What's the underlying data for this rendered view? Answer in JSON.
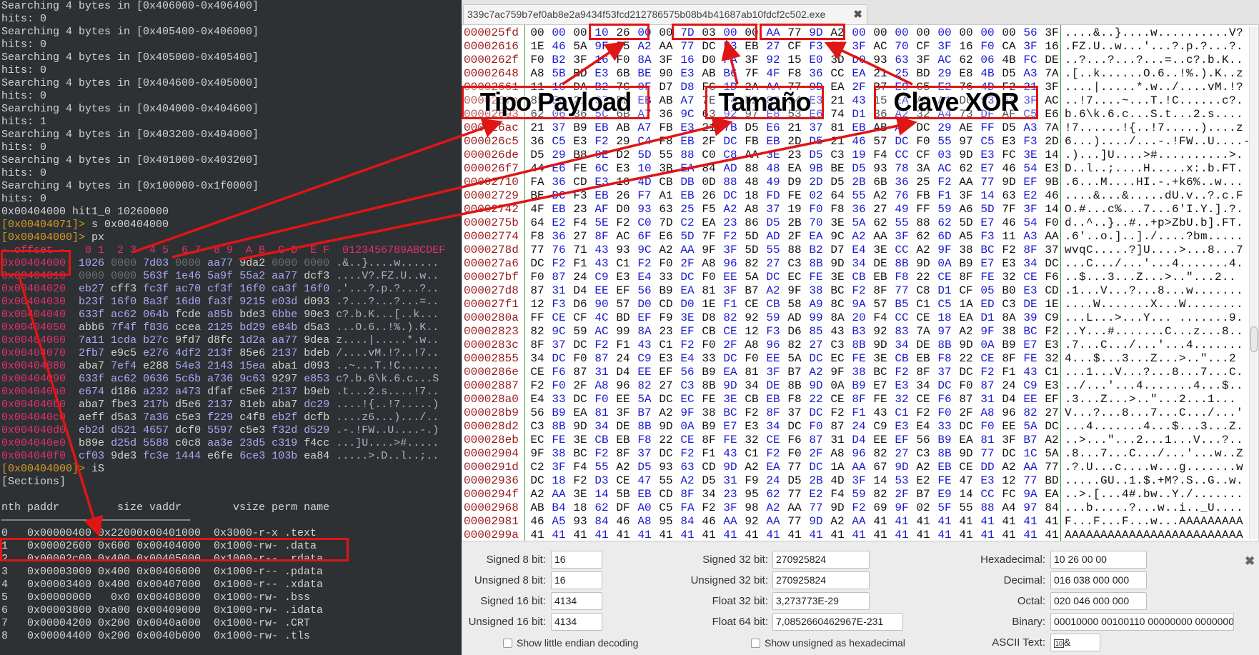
{
  "terminal": {
    "search_lines": [
      [
        "Searching 4 bytes in [0x406000-0x406400]",
        "hits: 0"
      ],
      [
        "Searching 4 bytes in [0x405400-0x406000]",
        "hits: 0"
      ],
      [
        "Searching 4 bytes in [0x405000-0x405400]",
        "hits: 0"
      ],
      [
        "Searching 4 bytes in [0x404600-0x405000]",
        "hits: 0"
      ],
      [
        "Searching 4 bytes in [0x404000-0x404600]",
        "hits: 1"
      ],
      [
        "Searching 4 bytes in [0x403200-0x404000]",
        "hits: 0"
      ],
      [
        "Searching 4 bytes in [0x401000-0x403200]",
        "hits: 0"
      ],
      [
        "Searching 4 bytes in [0x100000-0x1f0000]",
        "hits: 0"
      ]
    ],
    "hit_line": "0x00404000 hit1_0 10260000",
    "cmd1": {
      "prompt": "[0x00404071]>",
      "cmd": " s 0x00404000"
    },
    "cmd2": {
      "prompt": "[0x00404000]>",
      "cmd": " px"
    },
    "px_header": "- offset -   0 1  2 3  4 5  6 7  8 9  A B  C D  E F  0123456789ABCDEF",
    "px_rows": [
      [
        "0x00404000",
        "1026 0000 7d03 0000 aa77 9da2 0000 0000",
        ".&..}....w......"
      ],
      [
        "0x00404010",
        "0000 0000 563f 1e46 5a9f 55a2 aa77 dcf3",
        "....V?.FZ.U..w.."
      ],
      [
        "0x00404020",
        "eb27 cff3 fc3f ac70 cf3f 16f0 ca3f 16f0",
        ".'...?.p.?...?.."
      ],
      [
        "0x00404030",
        "b23f 16f0 8a3f 16d0 fa3f 9215 e03d d093",
        ".?...?...?...=.."
      ],
      [
        "0x00404040",
        "633f ac62 064b fcde a85b bde3 6bbe 90e3",
        "c?.b.K...[..k..."
      ],
      [
        "0x00404050",
        "abb6 7f4f f836 ccea 2125 bd29 e84b d5a3",
        "...O.6..!%.).K.."
      ],
      [
        "0x00404060",
        "7a11 1cda b27c 9fd7 d8fc 1d2a aa77 9dea",
        "z....|.....*.w.."
      ],
      [
        "0x00404070",
        "2fb7 e9c5 e276 4df2 213f 85e6 2137 bdeb",
        "/....vM.!?..!7.."
      ],
      [
        "0x00404080",
        "aba7 7ef4 e288 54e3 2143 15ea aba1 d093",
        "..~...T.!C......"
      ],
      [
        "0x00404090",
        "633f ac62 0636 5c6b a736 9c63 9297 e853",
        "c?.b.6\\k.6.c...S"
      ],
      [
        "0x004040a0",
        "e674 d186 a232 a473 dfaf c5e6 2137 b9eb",
        ".t...2.s....!7.."
      ],
      [
        "0x004040b0",
        "aba7 fbe3 217b d5e6 2137 81eb aba7 dc29",
        "....!{..!7.....)"
      ],
      [
        "0x004040c0",
        "aeff d5a3 7a36 c5e3 f229 c4f8 eb2f dcfb",
        "....z6...).../.."
      ],
      [
        "0x004040d0",
        "eb2d d521 4657 dcf0 5597 c5e3 f32d d529",
        ".-.!FW..U....-.)"
      ],
      [
        "0x004040e0",
        "b89e d25d 5588 c0c8 aa3e 23d5 c319 f4cc",
        "...]U....>#....."
      ],
      [
        "0x004040f0",
        "cf03 9de3 fc3e 1444 e6fe 6ce3 103b ea84",
        ".....>.D..l..;.."
      ]
    ],
    "cmd3": {
      "prompt": "[0x00404000]>",
      "cmd": " iS"
    },
    "sections_title": "[Sections]",
    "sections_header": "nth paddr         size vaddr        vsize perm name",
    "sections_rule": "―――――――――――――――――――――――――――――――――――――――――――――――――――",
    "sections": [
      [
        "0",
        "0x00000400",
        "0x2200",
        "0x00401000",
        "0x3000",
        "-r-x",
        ".text"
      ],
      [
        "1",
        "0x00002600",
        "0x600",
        "0x00404000",
        "0x1000",
        "-rw-",
        ".data"
      ],
      [
        "2",
        "0x00002c00",
        "0x400",
        "0x00405000",
        "0x1000",
        "-r--",
        ".rdata"
      ],
      [
        "3",
        "0x00003000",
        "0x400",
        "0x00406000",
        "0x1000",
        "-r--",
        ".pdata"
      ],
      [
        "4",
        "0x00003400",
        "0x400",
        "0x00407000",
        "0x1000",
        "-r--",
        ".xdata"
      ],
      [
        "5",
        "0x00000000",
        "0x0",
        "0x00408000",
        "0x1000",
        "-rw-",
        ".bss"
      ],
      [
        "6",
        "0x00003800",
        "0xa00",
        "0x00409000",
        "0x1000",
        "-rw-",
        ".idata"
      ],
      [
        "7",
        "0x00004200",
        "0x200",
        "0x0040a000",
        "0x1000",
        "-rw-",
        ".CRT"
      ],
      [
        "8",
        "0x00004400",
        "0x200",
        "0x0040b000",
        "0x1000",
        "-rw-",
        ".tls"
      ]
    ]
  },
  "hexeditor": {
    "tab_title": "339c7ac759b7ef0ab8e2a9434f53fcd212786575b08b4b41687ab10fdcf2c502.exe",
    "tab_close_icon": "close-icon",
    "rows": [
      [
        "000025fd",
        "00 00 00 10 26 00 00 7D 03 00 00 AA 77 9D A2 00 00 00 00 00 00 00 00 56 3F",
        "....&..}....w..........V?"
      ],
      [
        "00002616",
        "1E 46 5A 9F 55 A2 AA 77 DC F3 EB 27 CF F3 FC 3F AC 70 CF 3F 16 F0 CA 3F 16",
        ".FZ.U..w...'...?.p.?...?."
      ],
      [
        "0000262f",
        "F0 B2 3F 16 F0 8A 3F 16 D0 FA 3F 92 15 E0 3D D0 93 63 3F AC 62 06 4B FC DE",
        "..?...?...?...=..c?.b.K.."
      ],
      [
        "00002648",
        "A8 5B BD E3 6B BE 90 E3 AB B6 7F 4F F8 36 CC EA 21 25 BD 29 E8 4B D5 A3 7A",
        ".[..k......O.6..!%.).K..z"
      ],
      [
        "00002661",
        "11 1C DA B2 7C 0F D7 D8 FC 1D 2A AA 77 9D EA 2F B7 E9 C5 E2 76 4D F2 21 3F",
        "....|.....*.w../....vM.!?"
      ],
      [
        "0000267a",
        "85 E6 21 37 BD EB AB A7 7E F4 E2 88 54 E3 21 43 15 EA AB A1 D0 93 63 3F AC",
        "..!7....~...T.!C......c?."
      ],
      [
        "00002693",
        "62 06 36 5C 6B A7 36 9C 63 92 97 E8 53 E6 74 D1 86 A2 32 A4 73 DF AF C5 E6",
        "b.6\\k.6.c...S.t...2.s...."
      ],
      [
        "000026ac",
        "21 37 B9 EB AB A7 FB E3 21 7B D5 E6 21 37 81 EB AB A7 DC 29 AE FF D5 A3 7A",
        "!7......!{..!7.....)....z"
      ],
      [
        "000026c5",
        "36 C5 E3 F2 29 C4 F8 EB 2F DC FB EB 2D D5 21 46 57 DC F0 55 97 C5 E3 F3 2D",
        "6...)..../...-.!FW..U....-"
      ],
      [
        "000026de",
        "D5 29 B8 9E D2 5D 55 88 C0 C8 AA 3E 23 D5 C3 19 F4 CC CF 03 9D E3 FC 3E 14",
        ".)...]U....>#..........>."
      ],
      [
        "000026f7",
        "44 E6 FE 6C E3 10 3B EA 84 AD 88 48 EA 9B BE D5 93 78 3A AC 62 E7 46 54 E3",
        "D..l..;....H.....x:.b.FT."
      ],
      [
        "00002710",
        "FA 36 CD E3 10 4D CB DB 0D 88 48 49 D9 2D D5 2B 6B 36 25 F2 AA 77 9D EF 9B",
        ".6...M....HI.-.+k6%..w..."
      ],
      [
        "00002729",
        "BE DC F3 EB 26 F7 A1 EB 26 DC 18 FD FE 02 64 55 A2 76 FB F1 3F 14 63 E2 46",
        "....&...&.....dU.v..?.c.F"
      ],
      [
        "00002742",
        "4F EB 23 AF D0 93 63 25 F5 A2 A8 37 19 F0 F8 36 27 49 FF 59 A6 5D 7F 3F 14",
        "O.#...c%...7...6'I.Y.].?."
      ],
      [
        "0000275b",
        "64 E2 F4 5E F2 C0 7D C2 EA 23 86 D5 2B 70 3E 5A 62 55 88 62 5D E7 46 54 F0",
        "d..^..}..#..+p>ZbU.b].FT."
      ],
      [
        "00002774",
        "F8 36 27 8F AC 6F E6 5D 7F F2 5D AD 2F EA 9C A2 AA 3F 62 6D A5 F3 11 A3 AA",
        ".6'..o.]..]./....?bm....."
      ],
      [
        "0000278d",
        "77 76 71 43 93 9C A2 AA 9F 3F 5D 55 88 B2 D7 E4 3E CC A2 9F 38 BC F2 8F 37",
        "wvqC.....?]U....>...8...7"
      ],
      [
        "000027a6",
        "DC F2 F1 43 C1 F2 F0 2F A8 96 82 27 C3 8B 9D 34 DE 8B 9D 0A B9 E7 E3 34 DC",
        "...C.../...'...4.......4."
      ],
      [
        "000027bf",
        "F0 87 24 C9 E3 E4 33 DC F0 EE 5A DC EC FE 3E CB EB F8 22 CE 8F FE 32 CE F6",
        "..$...3...Z...>..\"...2.."
      ],
      [
        "000027d8",
        "87 31 D4 EE EF 56 B9 EA 81 3F B7 A2 9F 38 BC F2 8F 77 C8 D1 CF 05 B0 E3 CD",
        ".1...V...?...8...w......."
      ],
      [
        "000027f1",
        "12 F3 D6 90 57 D0 CD D0 1E F1 CE CB 58 A9 8C 9A 57 B5 C1 C5 1A ED C3 DE 1E",
        "....W.......X...W........"
      ],
      [
        "0000280a",
        "FF CE CF 4C BD EF F9 3E D8 82 92 59 AD 99 8A 20 F4 CC CE 18 EA D1 8A 39 C9",
        "...L...>...Y... .......9."
      ],
      [
        "00002823",
        "82 9C 59 AC 99 8A 23 EF CB CE 12 F3 D6 85 43 B3 92 83 7A 97 A2 9F 38 BC F2",
        "..Y...#.......C...z...8.."
      ],
      [
        "0000283c",
        "8F 37 DC F2 F1 43 C1 F2 F0 2F A8 96 82 27 C3 8B 9D 34 DE 8B 9D 0A B9 E7 E3",
        ".7...C.../...'...4......."
      ],
      [
        "00002855",
        "34 DC F0 87 24 C9 E3 E4 33 DC F0 EE 5A DC EC FE 3E CB EB F8 22 CE 8F FE 32",
        "4...$...3...Z...>..\"...2"
      ],
      [
        "0000286e",
        "CE F6 87 31 D4 EE EF 56 B9 EA 81 3F B7 A2 9F 38 BC F2 8F 37 DC F2 F1 43 C1",
        "...1...V...?...8...7...C."
      ],
      [
        "00002887",
        "F2 F0 2F A8 96 82 27 C3 8B 9D 34 DE 8B 9D 0A B9 E7 E3 34 DC F0 87 24 C9 E3",
        "../...'...4.......4...$.."
      ],
      [
        "000028a0",
        "E4 33 DC F0 EE 5A DC EC FE 3E CB EB F8 22 CE 8F FE 32 CE F6 87 31 D4 EE EF",
        ".3...Z...>..\"...2...1..."
      ],
      [
        "000028b9",
        "56 B9 EA 81 3F B7 A2 9F 38 BC F2 8F 37 DC F2 F1 43 C1 F2 F0 2F A8 96 82 27",
        "V...?...8...7...C.../...'"
      ],
      [
        "000028d2",
        "C3 8B 9D 34 DE 8B 9D 0A B9 E7 E3 34 DC F0 87 24 C9 E3 E4 33 DC F0 EE 5A DC",
        "...4.......4...$...3...Z."
      ],
      [
        "000028eb",
        "EC FE 3E CB EB F8 22 CE 8F FE 32 CE F6 87 31 D4 EE EF 56 B9 EA 81 3F B7 A2",
        "..>...\"...2...1...V...?.."
      ],
      [
        "00002904",
        "9F 38 BC F2 8F 37 DC F2 F1 43 C1 F2 F0 2F A8 96 82 27 C3 8B 9D 77 DC 1C 5A",
        ".8...7...C.../...'...w..Z"
      ],
      [
        "0000291d",
        "C2 3F F4 55 A2 D5 93 63 CD 9D A2 EA 77 DC 1A AA 67 9D A2 EB CE DD A2 AA 77",
        ".?.U...c....w...g.......w"
      ],
      [
        "00002936",
        "DC 18 F2 D3 CE 47 55 A2 D5 31 F9 24 D5 2B 4D 3F 14 53 E2 FE 47 E3 12 77 BD",
        ".....GU..1.$.+M?.S..G..w."
      ],
      [
        "0000294f",
        "A2 AA 3E 14 5B EB CD 8F 34 23 95 62 77 E2 F4 59 82 2F B7 E9 14 CC FC 9A EA",
        "..>.[...4#.bw..Y./......."
      ],
      [
        "00002968",
        "AB B4 18 62 DF A0 C5 FA F2 3F 98 A2 AA 77 9D F2 69 9F 02 5F 55 88 A4 97 84",
        "...b.....?...w..i.._U...."
      ],
      [
        "00002981",
        "46 A5 93 84 46 A8 95 84 46 AA 92 AA 77 9D A2 AA 41 41 41 41 41 41 41 41 41",
        "F...F...F...w...AAAAAAAAA"
      ],
      [
        "0000299a",
        "41 41 41 41 41 41 41 41 41 41 41 41 41 41 41 41 41 41 41 41 41 41 41 41 41",
        "AAAAAAAAAAAAAAAAAAAAAAAAA"
      ]
    ]
  },
  "inspector": {
    "signed8": {
      "label": "Signed 8 bit:",
      "value": "16"
    },
    "unsigned8": {
      "label": "Unsigned 8 bit:",
      "value": "16"
    },
    "signed16": {
      "label": "Signed 16 bit:",
      "value": "4134"
    },
    "unsigned16": {
      "label": "Unsigned 16 bit:",
      "value": "4134"
    },
    "signed32": {
      "label": "Signed 32 bit:",
      "value": "270925824"
    },
    "unsigned32": {
      "label": "Unsigned 32 bit:",
      "value": "270925824"
    },
    "float32": {
      "label": "Float 32 bit:",
      "value": "3,273773E-29"
    },
    "float64": {
      "label": "Float 64 bit:",
      "value": "7,0852660462967E-231"
    },
    "hex": {
      "label": "Hexadecimal:",
      "value": "10 26 00 00"
    },
    "decimal": {
      "label": "Decimal:",
      "value": "016 038 000 000"
    },
    "octal": {
      "label": "Octal:",
      "value": "020 046 000 000"
    },
    "binary": {
      "label": "Binary:",
      "value": "00010000 00100110 00000000 00000000"
    },
    "ascii": {
      "label": "ASCII Text:",
      "value": "&"
    },
    "little_endian": {
      "label": "Show little endian decoding",
      "checked": false
    },
    "unsigned_hex": {
      "label": "Show unsigned as hexadecimal",
      "checked": false
    }
  },
  "annotations": {
    "tipo": "Tipo Payload",
    "tamano": "Tamaño",
    "clave": "Clave XOR",
    "color": "#e01515"
  }
}
